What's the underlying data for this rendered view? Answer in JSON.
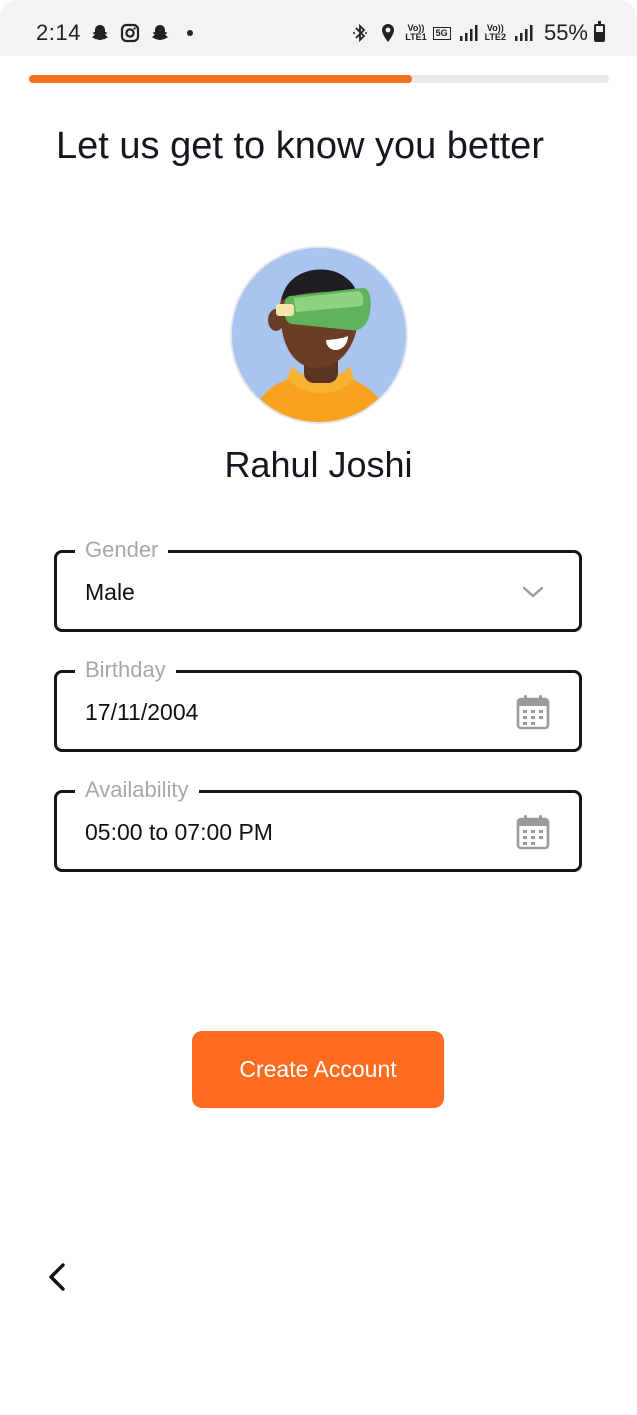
{
  "status_bar": {
    "time": "2:14",
    "battery": "55%",
    "battery_level": 0.55,
    "network_tags": [
      "Vo)) LTE1",
      "5G",
      "Vo)) LTE2"
    ],
    "icons": [
      "snapchat-icon",
      "instagram-icon",
      "snapchat-icon",
      "bluetooth-icon",
      "location-icon",
      "signal-icon",
      "battery-icon"
    ]
  },
  "progress": {
    "value": 0.66,
    "accent": "#f36f21"
  },
  "page": {
    "heading": "Let us get to know you better"
  },
  "profile": {
    "name": "Rahul Joshi"
  },
  "form": {
    "gender": {
      "label": "Gender",
      "value": "Male",
      "icon": "chevron-down-icon"
    },
    "birthday": {
      "label": "Birthday",
      "value": "17/11/2004",
      "icon": "calendar-icon"
    },
    "availability": {
      "label": "Availability",
      "value": "05:00 to 07:00 PM",
      "icon": "calendar-icon"
    }
  },
  "actions": {
    "create_account": "Create Account",
    "button_color": "#ff6b1f"
  }
}
